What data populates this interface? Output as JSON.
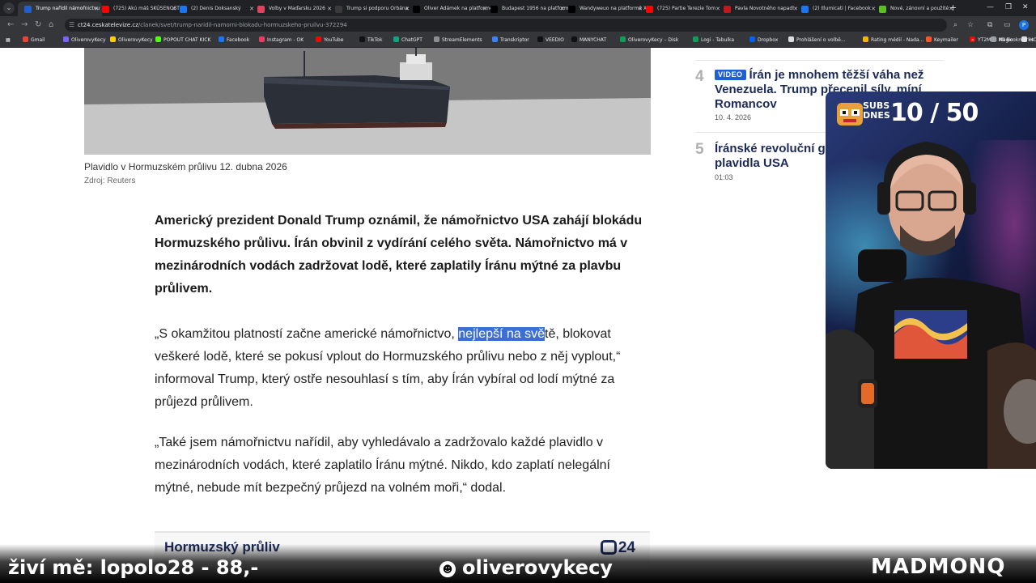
{
  "browser": {
    "tabs": [
      {
        "title": "Trump nařídil námořnictvu",
        "icon_color": "#1f5fd1",
        "active": true
      },
      {
        "title": "(725) Akú máš SKÚSENOST",
        "icon_color": "#ff0000"
      },
      {
        "title": "(2) Denis Doksanský",
        "icon_color": "#1877f2"
      },
      {
        "title": "Volby v Maďarsku 2026",
        "icon_color": "#e4405f"
      },
      {
        "title": "Trump si podporu Orbána",
        "icon_color": "#3a3a3a"
      },
      {
        "title": "Oliver Adámek na platformě X",
        "icon_color": "#000000"
      },
      {
        "title": "Budapest 1956 na platformě X",
        "icon_color": "#000000"
      },
      {
        "title": "Wandyweuo na platformě X",
        "icon_color": "#000000"
      },
      {
        "title": "(725) Partie Terezie Tom",
        "icon_color": "#ff0000"
      },
      {
        "title": "Pavla Novotného napadl",
        "icon_color": "#c4161c"
      },
      {
        "title": "(2) Illumicati | Facebook",
        "icon_color": "#1877f2"
      },
      {
        "title": "Nové, zánovní a použité",
        "icon_color": "#5bbf21"
      }
    ],
    "url_host": "ct24.ceskatelevize.cz",
    "url_path": "/clanek/svet/trump-naridil-namorni-blokadu-hormuzskeho-pruilvu-372294",
    "bookmarks": [
      {
        "label": "Gmail",
        "color": "#ea4335"
      },
      {
        "label": "OliverovyKecy",
        "color": "#7b61ff"
      },
      {
        "label": "OliverovyKecy",
        "color": "#ffcc00"
      },
      {
        "label": "POPOUT CHAT KICK",
        "color": "#53fc18"
      },
      {
        "label": "Facebook",
        "color": "#1877f2"
      },
      {
        "label": "Instagram - OK",
        "color": "#e4405f"
      },
      {
        "label": "YouTube",
        "color": "#ff0000"
      },
      {
        "label": "TikTok",
        "color": "#111111"
      },
      {
        "label": "ChatGPT",
        "color": "#10a37f"
      },
      {
        "label": "StreamElements",
        "color": "#8e8e8e"
      },
      {
        "label": "Transkriptor",
        "color": "#3b82f6"
      },
      {
        "label": "VEEDIO",
        "color": "#111111"
      },
      {
        "label": "MANYCHAT",
        "color": "#111111"
      },
      {
        "label": "OliverovyKecy – Disk",
        "color": "#0f9d58"
      },
      {
        "label": "Logi - Tabulka",
        "color": "#0f9d58"
      },
      {
        "label": "Dropbox",
        "color": "#0061ff"
      },
      {
        "label": "Prohlášení o volbě...",
        "color": "#dddddd"
      },
      {
        "label": "Rating médií - Nada...",
        "color": "#f4b400"
      },
      {
        "label": "Keymailer",
        "color": "#ff5722"
      },
      {
        "label": "YT2MP3 Magic",
        "color": "#ff0000"
      },
      {
        "label": "HOOKS",
        "color": "#dddddd"
      }
    ],
    "all_bookmarks": "All Bookmarks",
    "profile_initial": "P"
  },
  "article": {
    "caption": "Plavidlo v Hormuzském průlivu 12. dubna 2026",
    "source": "Zdroj: Reuters",
    "lead": "Americký prezident Donald Trump oznámil, že námořnictvo USA zahájí blokádu Hormuzského průlivu. Írán obvinil z vydírání celého světa. Námořnictvo má v mezinárodních vodách zadržovat lodě, které zaplatily Íránu mýtné za plavbu průlivem.",
    "p1_before": "„S okamžitou platností začne americké námořnictvo, ",
    "p1_highlight": "nejlepší na svě",
    "p1_after": "tě, blokovat veškeré lodě, které se pokusí vplout do Hormuzského průlivu nebo z něj vyplout,“ informoval Trump, který ostře nesouhlasí s tím, aby Írán vybíral od lodí mýtné za průjezd průlivem.",
    "p2": "„Také jsem námořnictvu nařídil, aby vyhledávalo a zadržovalo každé plavidlo v mezinárodních vodách, které zaplatilo Íránu mýtné. Nikdo, kdo zaplatí nelegální mýtné, nebude mít bezpečný průjezd na volném moři,“ dodal.",
    "embed_title": "Hormuzský průliv",
    "embed_logo": "24"
  },
  "sidebar": {
    "items": [
      {
        "num": "4",
        "badge": "VIDEO",
        "title": "Írán je mnohem těžší váha než Venezuela. Trump přecenil síly, míní Romancov",
        "date": "10. 4. 2026"
      },
      {
        "num": "5",
        "badge": "",
        "title": "Íránské revoluční gardy blokují vojenská plavidla USA",
        "date": "01:03"
      }
    ]
  },
  "overlay": {
    "subs_label_1": "SUBS",
    "subs_label_2": "DNES",
    "subs_count": "10 / 50",
    "donation": "živí mě: lopolo28 - 88,-",
    "channel": "oliverovykecy",
    "brand": "MADMONQ"
  }
}
